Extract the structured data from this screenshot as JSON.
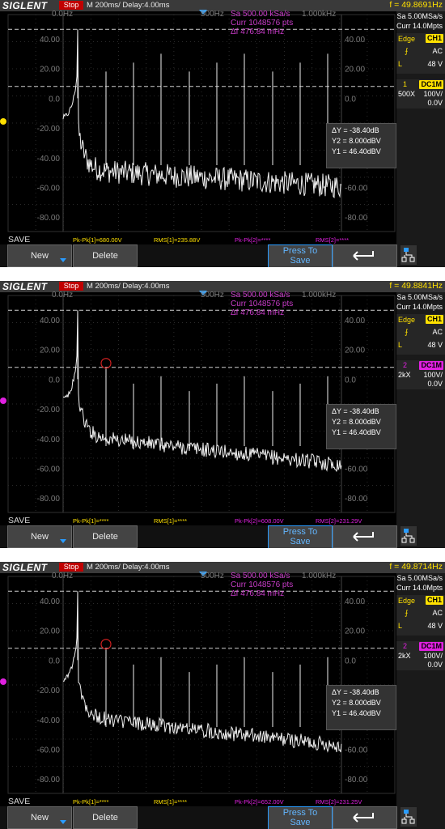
{
  "screens": [
    {
      "brand": "SIGLENT",
      "run_state": "Stop",
      "timebase": "M 200ms/",
      "delay": "Delay:4.00ms",
      "frequency": "f = 49.8691Hz",
      "fft_start": "0.0Hz",
      "fft_mid": "500Hz",
      "fft_end": "1.000kHz",
      "fft_info": [
        "Sa 500.00 kSa/s",
        "Curr 1048576 pts",
        "Δf 476.84 mHz"
      ],
      "sample_rate": "Sa 5.00MSa/s",
      "memory": "Curr 14.0Mpts",
      "trigger_type": "Edge",
      "trigger_src": "CH1",
      "coupling": "AC",
      "trigger_level_label": "L",
      "trigger_level": "48 V",
      "channel_num": "1",
      "channel_coupling": "DC1M",
      "probe": "500X",
      "volts_div": "100V/",
      "offset": "0.0V",
      "cursor_dy": "ΔY = -38.40dB",
      "cursor_y2": "Y2 = 8.000dBV",
      "cursor_y1": "Y1 = 46.40dBV",
      "save_label": "SAVE",
      "meas1_pkpk": "Pk-Pk[1]=680.00V",
      "meas1_rms": "RMS[1]=235.88V",
      "meas2_pkpk": "Pk-Pk[2]=****",
      "meas2_rms": "RMS[2]=****",
      "btn_new": "New",
      "btn_delete": "Delete",
      "btn_press1": "Press To",
      "btn_press2": "Save",
      "y_labels": [
        "40.00",
        "20.00",
        "0.0",
        "-20.00",
        "-40.00",
        "-60.00",
        "-80.00"
      ],
      "channel_color": "#ffe000",
      "marker_circle": false
    },
    {
      "brand": "SIGLENT",
      "run_state": "Stop",
      "timebase": "M 200ms/",
      "delay": "Delay:4.00ms",
      "frequency": "f = 49.8841Hz",
      "fft_start": "0.0Hz",
      "fft_mid": "500Hz",
      "fft_end": "1.000kHz",
      "fft_info": [
        "Sa 500.00 kSa/s",
        "Curr 1048576 pts",
        "Δf 476.84 mHz"
      ],
      "sample_rate": "Sa 5.00MSa/s",
      "memory": "Curr 14.0Mpts",
      "trigger_type": "Edge",
      "trigger_src": "CH1",
      "coupling": "AC",
      "trigger_level_label": "L",
      "trigger_level": "48 V",
      "channel_num": "2",
      "channel_coupling": "DC1M",
      "probe": "2kX",
      "volts_div": "100V/",
      "offset": "0.0V",
      "cursor_dy": "ΔY = -38.40dB",
      "cursor_y2": "Y2 = 8.000dBV",
      "cursor_y1": "Y1 = 46.40dBV",
      "save_label": "SAVE",
      "meas1_pkpk": "Pk-Pk[1]=****",
      "meas1_rms": "RMS[1]=****",
      "meas2_pkpk": "Pk-Pk[2]=608.00V",
      "meas2_rms": "RMS[2]=231.29V",
      "btn_new": "New",
      "btn_delete": "Delete",
      "btn_press1": "Press To",
      "btn_press2": "Save",
      "y_labels": [
        "40.00",
        "20.00",
        "0.0",
        "-20.00",
        "-40.00",
        "-60.00",
        "-80.00"
      ],
      "channel_color": "#e020e0",
      "marker_circle": true
    },
    {
      "brand": "SIGLENT",
      "run_state": "Stop",
      "timebase": "M 200ms/",
      "delay": "Delay:4.00ms",
      "frequency": "f = 49.8714Hz",
      "fft_start": "0.0Hz",
      "fft_mid": "500Hz",
      "fft_end": "1.000kHz",
      "fft_info": [
        "Sa 500.00 kSa/s",
        "Curr 1048576 pts",
        "Δf 476.84 mHz"
      ],
      "sample_rate": "Sa 5.00MSa/s",
      "memory": "Curr 14.0Mpts",
      "trigger_type": "Edge",
      "trigger_src": "CH1",
      "coupling": "AC",
      "trigger_level_label": "L",
      "trigger_level": "48 V",
      "channel_num": "2",
      "channel_coupling": "DC1M",
      "probe": "2kX",
      "volts_div": "100V/",
      "offset": "0.0V",
      "cursor_dy": "ΔY = -38.40dB",
      "cursor_y2": "Y2 = 8.000dBV",
      "cursor_y1": "Y1 = 46.40dBV",
      "save_label": "SAVE",
      "meas1_pkpk": "Pk-Pk[1]=****",
      "meas1_rms": "RMS[1]=****",
      "meas2_pkpk": "Pk-Pk[2]=652.00V",
      "meas2_rms": "RMS[2]=231.25V",
      "btn_new": "New",
      "btn_delete": "Delete",
      "btn_press1": "Press To",
      "btn_press2": "Save",
      "y_labels": [
        "40.00",
        "20.00",
        "0.0",
        "-20.00",
        "-40.00",
        "-60.00",
        "-80.00"
      ],
      "channel_color": "#e020e0",
      "marker_circle": true
    }
  ]
}
